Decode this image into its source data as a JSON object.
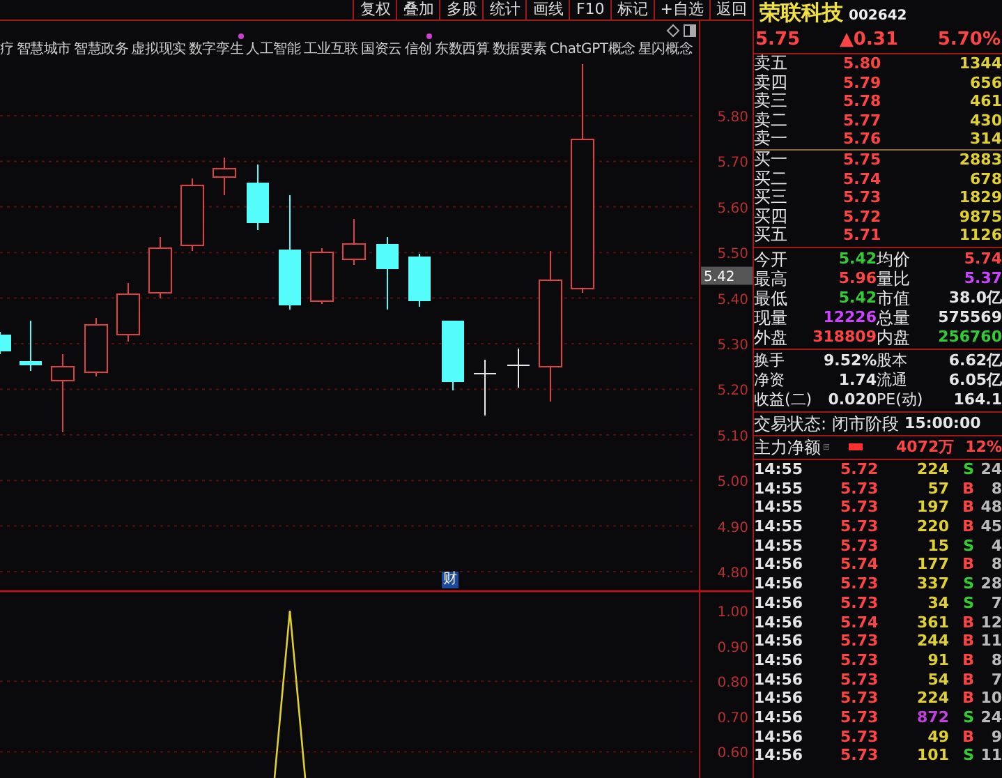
{
  "toolbar": {
    "buttons": [
      "复权",
      "叠加",
      "多股",
      "统计",
      "画线",
      "F10",
      "标记",
      "+自选",
      "返回"
    ]
  },
  "concept_tags": [
    {
      "label": "疗",
      "marked": false
    },
    {
      "label": "智慧城市",
      "marked": false
    },
    {
      "label": "智慧政务",
      "marked": false
    },
    {
      "label": "虚拟现实",
      "marked": false
    },
    {
      "label": "数字孪生",
      "marked": true
    },
    {
      "label": "人工智能",
      "marked": false
    },
    {
      "label": "工业互联",
      "marked": false
    },
    {
      "label": "国资云",
      "marked": false
    },
    {
      "label": "信创",
      "marked": true
    },
    {
      "label": "东数西算",
      "marked": false
    },
    {
      "label": "数据要素",
      "marked": false
    },
    {
      "label": "ChatGPT概念",
      "marked": false
    },
    {
      "label": "星闪概念",
      "marked": false
    }
  ],
  "chart": {
    "price_axis": [
      "5.80",
      "5.70",
      "5.60",
      "5.50",
      "5.40",
      "5.30",
      "5.20",
      "5.10",
      "5.00",
      "4.90",
      "4.80"
    ],
    "price_marker": "5.42",
    "badge": "财",
    "indicator_axis": [
      "1.00",
      "0.90",
      "0.80",
      "0.70",
      "0.60"
    ]
  },
  "quote": {
    "name": "荣联科技",
    "code": "002642",
    "price": "5.75",
    "change": "▲0.31",
    "change_pct": "5.70%"
  },
  "order_book": {
    "asks": [
      {
        "label": "卖五",
        "price": "5.80",
        "volume": "1344"
      },
      {
        "label": "卖四",
        "price": "5.79",
        "volume": "656"
      },
      {
        "label": "卖三",
        "price": "5.78",
        "volume": "461"
      },
      {
        "label": "卖二",
        "price": "5.77",
        "volume": "430"
      },
      {
        "label": "卖一",
        "price": "5.76",
        "volume": "314"
      }
    ],
    "bids": [
      {
        "label": "买一",
        "price": "5.75",
        "volume": "2883"
      },
      {
        "label": "买二",
        "price": "5.74",
        "volume": "678"
      },
      {
        "label": "买三",
        "price": "5.73",
        "volume": "1829"
      },
      {
        "label": "买四",
        "price": "5.72",
        "volume": "9875"
      },
      {
        "label": "买五",
        "price": "5.71",
        "volume": "1126"
      }
    ]
  },
  "stats": [
    {
      "label": "今开",
      "value": "5.42",
      "color": "#33cc33"
    },
    {
      "label": "均价",
      "value": "5.74",
      "color": "#ff4444"
    },
    {
      "label": "最高",
      "value": "5.96",
      "color": "#ff4444"
    },
    {
      "label": "量比",
      "value": "5.37",
      "color": "#cc44ff"
    },
    {
      "label": "最低",
      "value": "5.42",
      "color": "#33cc33"
    },
    {
      "label": "市值",
      "value": "38.0亿",
      "color": "#e6e6e6"
    },
    {
      "label": "现量",
      "value": "12226",
      "color": "#cc44ff"
    },
    {
      "label": "总量",
      "value": "575569",
      "color": "#e6e6e6"
    },
    {
      "label": "外盘",
      "value": "318809",
      "color": "#ff4444"
    },
    {
      "label": "内盘",
      "value": "256760",
      "color": "#33cc33"
    }
  ],
  "fundamentals": [
    {
      "label": "换手",
      "value": "9.52%"
    },
    {
      "label": "股本",
      "value": "6.62亿"
    },
    {
      "label": "净资",
      "value": "1.74"
    },
    {
      "label": "流通",
      "value": "6.05亿"
    },
    {
      "label": "收益(二)",
      "value": "0.020"
    },
    {
      "label": "PE(动)",
      "value": "164.1"
    }
  ],
  "trade_status": {
    "label": "交易状态:",
    "value": "闭市阶段",
    "time": "15:00:00"
  },
  "main_flow": {
    "label": "主力净额",
    "amount": "4072万",
    "ratio": "12%"
  },
  "trades": [
    {
      "time": "14:55",
      "price": "5.72",
      "volume": "224",
      "large": false,
      "side": "S",
      "kind": "sell",
      "count": "24"
    },
    {
      "time": "14:55",
      "price": "5.73",
      "volume": "57",
      "large": false,
      "side": "B",
      "kind": "buy",
      "count": "8"
    },
    {
      "time": "14:55",
      "price": "5.73",
      "volume": "197",
      "large": false,
      "side": "B",
      "kind": "buy",
      "count": "48"
    },
    {
      "time": "14:55",
      "price": "5.73",
      "volume": "220",
      "large": false,
      "side": "B",
      "kind": "buy",
      "count": "45"
    },
    {
      "time": "14:55",
      "price": "5.73",
      "volume": "15",
      "large": false,
      "side": "S",
      "kind": "sell",
      "count": "4"
    },
    {
      "time": "14:56",
      "price": "5.74",
      "volume": "177",
      "large": false,
      "side": "B",
      "kind": "buy",
      "count": "8"
    },
    {
      "time": "14:56",
      "price": "5.73",
      "volume": "337",
      "large": false,
      "side": "S",
      "kind": "sell",
      "count": "28"
    },
    {
      "time": "14:56",
      "price": "5.73",
      "volume": "34",
      "large": false,
      "side": "S",
      "kind": "sell",
      "count": "7"
    },
    {
      "time": "14:56",
      "price": "5.74",
      "volume": "361",
      "large": false,
      "side": "B",
      "kind": "buy",
      "count": "12"
    },
    {
      "time": "14:56",
      "price": "5.73",
      "volume": "244",
      "large": false,
      "side": "B",
      "kind": "buy",
      "count": "11"
    },
    {
      "time": "14:56",
      "price": "5.73",
      "volume": "91",
      "large": false,
      "side": "B",
      "kind": "buy",
      "count": "8"
    },
    {
      "time": "14:56",
      "price": "5.73",
      "volume": "54",
      "large": false,
      "side": "B",
      "kind": "buy",
      "count": "7"
    },
    {
      "time": "14:56",
      "price": "5.73",
      "volume": "224",
      "large": false,
      "side": "B",
      "kind": "buy",
      "count": "10"
    },
    {
      "time": "14:56",
      "price": "5.73",
      "volume": "872",
      "large": true,
      "side": "S",
      "kind": "sell",
      "count": "24"
    },
    {
      "time": "14:56",
      "price": "5.73",
      "volume": "49",
      "large": false,
      "side": "B",
      "kind": "buy",
      "count": "9"
    },
    {
      "time": "14:56",
      "price": "5.73",
      "volume": "101",
      "large": false,
      "side": "S",
      "kind": "sell",
      "count": "11"
    }
  ]
}
